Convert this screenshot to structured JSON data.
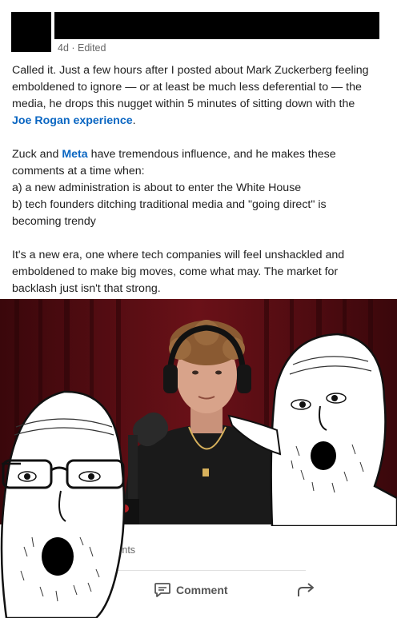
{
  "post": {
    "meta": "4d · Edited",
    "paragraph1": {
      "line1": "Called it. Just a few hours after I posted about Mark Zuckerberg feeling",
      "line2": "emboldened to ignore — or at least be much less deferential to — the",
      "line3": "media, he drops this nugget within 5 minutes of sitting down with the",
      "link": "Joe Rogan experience",
      "tail": "."
    },
    "paragraph2": {
      "pre": "Zuck and ",
      "link": "Meta",
      "post": " have tremendous influence, and he makes these",
      "line2": "comments at a time when:",
      "line3": "a) a new administration is about to enter the White House",
      "line4": "b) tech founders ditching traditional media and \"going direct\" is",
      "line5": "becoming trendy"
    },
    "paragraph3": {
      "line1": "It's a new era, one where tech companies will feel unshackled and",
      "line2": "emboldened to make big moves, come what may. The market for",
      "line3": "backlash just isn't that strong."
    }
  },
  "engagement": {
    "counts_text": "ments",
    "comment_label": "Comment"
  },
  "colors": {
    "link": "#0a66c2",
    "meta": "#666666",
    "curtain": "#5a0d12"
  },
  "icons": [
    "comment-icon",
    "share-arrow-icon"
  ]
}
